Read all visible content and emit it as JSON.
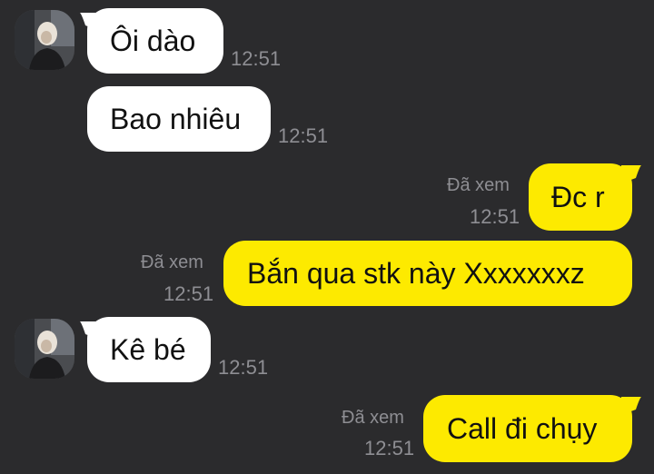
{
  "colors": {
    "background": "#2b2b2d",
    "incoming_bubble": "#ffffff",
    "outgoing_bubble": "#fdea00",
    "meta_text": "#8e8e93"
  },
  "messages": [
    {
      "direction": "incoming",
      "text": "Ôi dào",
      "time": "12:51"
    },
    {
      "direction": "incoming",
      "text": "Bao nhiêu",
      "time": "12:51"
    },
    {
      "direction": "outgoing",
      "text": "Đc r",
      "status": "Đã xem",
      "time": "12:51"
    },
    {
      "direction": "outgoing",
      "text": "Bắn qua stk này Xxxxxxxz",
      "status": "Đã xem",
      "time": "12:51"
    },
    {
      "direction": "incoming",
      "text": "Kê bé",
      "time": "12:51"
    },
    {
      "direction": "outgoing",
      "text": "Call đi chụy",
      "status": "Đã xem",
      "time": "12:51"
    }
  ],
  "avatar": {
    "icon": "contact-avatar-photo"
  }
}
